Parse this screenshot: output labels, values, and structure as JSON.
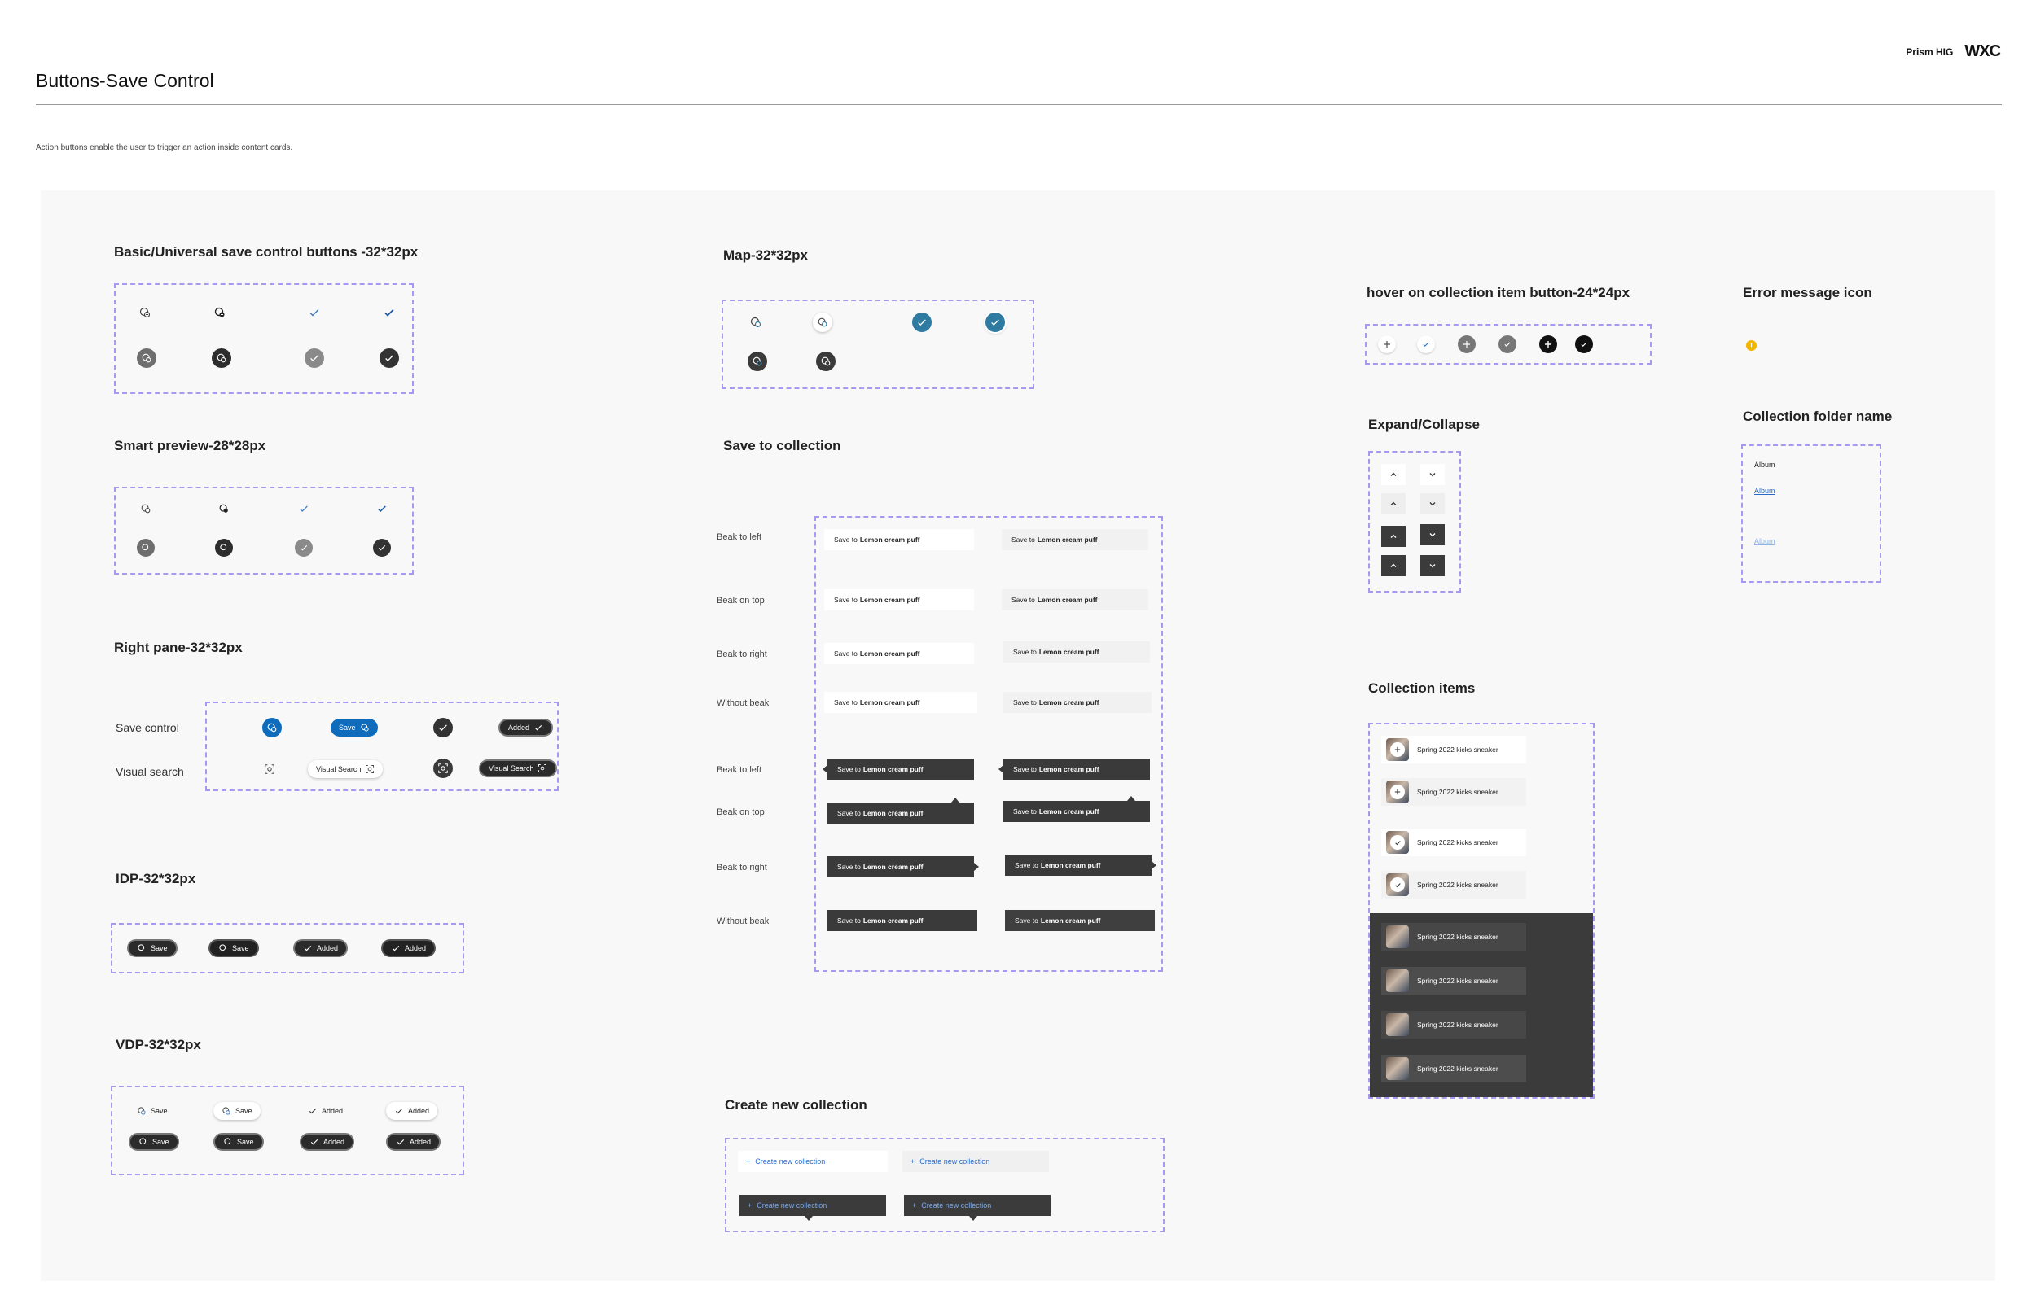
{
  "header": {
    "title": "Buttons-Save Control",
    "description": "Action buttons enable the user to trigger an action inside content cards.",
    "brand_name": "Prism HIG",
    "brand_logo": "WXC"
  },
  "colors": {
    "accent": "#0f6cbd",
    "dash": "#a999ee",
    "map_teal": "#2e7aa1",
    "error": "#f2b500",
    "dark": "#3a3a3a"
  },
  "sections": {
    "basic": {
      "title": "Basic/Universal save control buttons -32*32px"
    },
    "smart": {
      "title": "Smart preview-28*28px"
    },
    "right_pane": {
      "title": "Right pane-32*32px",
      "row_save": "Save control",
      "row_visual": "Visual search",
      "save_label": "Save",
      "added_label": "Added",
      "visual_label": "Visual Search"
    },
    "idp": {
      "title": "IDP-32*32px",
      "save_label": "Save",
      "added_label": "Added"
    },
    "vdp": {
      "title": "VDP-32*32px",
      "save_label": "Save",
      "added_label": "Added"
    },
    "map": {
      "title": "Map-32*32px"
    },
    "save_collection": {
      "title": "Save to collection",
      "rows": [
        "Beak to left",
        "Beak on top",
        "Beak to right",
        "Without beak",
        "Beak to left",
        "Beak on top",
        "Beak to right",
        "Without beak"
      ],
      "prefix": "Save to",
      "collection": "Lemon cream puff"
    },
    "create": {
      "title": "Create new collection",
      "label": "Create new collection"
    },
    "hover": {
      "title": "hover on collection item button-24*24px"
    },
    "error": {
      "title": "Error message icon"
    },
    "expand": {
      "title": "Expand/Collapse"
    },
    "folder": {
      "title": "Collection folder name",
      "names": [
        "Album",
        "Album",
        "Album"
      ]
    },
    "items": {
      "title": "Collection items",
      "item_label": "Spring 2022 kicks sneaker"
    }
  }
}
